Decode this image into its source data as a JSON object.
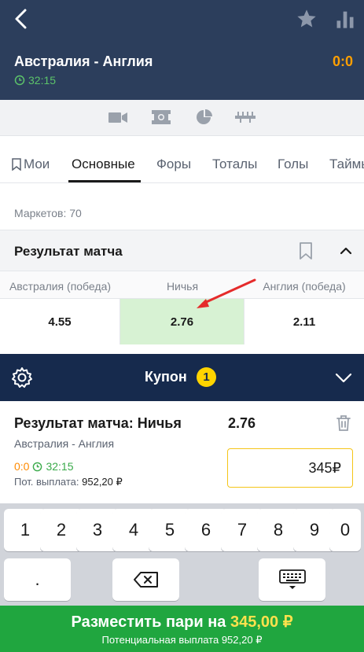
{
  "header": {
    "title": "Австралия - Англия",
    "score": "0:0",
    "time": "32:15"
  },
  "media_icons": [
    "video-icon",
    "field-icon",
    "stats-pie-icon",
    "timeline-icon"
  ],
  "tabs": [
    {
      "label": "Мои",
      "icon": "bookmark-icon"
    },
    {
      "label": "Основные",
      "active": true
    },
    {
      "label": "Форы"
    },
    {
      "label": "Тоталы"
    },
    {
      "label": "Голы"
    },
    {
      "label": "Таймы"
    }
  ],
  "markets": {
    "count_text": "Маркетов: 70"
  },
  "market": {
    "title": "Результат матча",
    "outcomes": [
      {
        "label": "Австралия (победа)",
        "odd": "4.55",
        "selected": false
      },
      {
        "label": "Ничья",
        "odd": "2.76",
        "selected": true
      },
      {
        "label": "Англия (победа)",
        "odd": "2.11",
        "selected": false
      }
    ]
  },
  "coupon": {
    "title": "Купон",
    "count": "1",
    "bet": {
      "title": "Результат матча: Ничья",
      "odd": "2.76",
      "match": "Австралия - Англия",
      "score": "0:0",
      "time": "32:15",
      "payout_label": "Пот. выплата:",
      "payout_value": "952,20 ₽",
      "stake": "345₽"
    }
  },
  "keyboard": {
    "keys": [
      "1",
      "2",
      "3",
      "4",
      "5",
      "6",
      "7",
      "8",
      "9",
      "0"
    ],
    "dot": "."
  },
  "place_bet": {
    "label": "Разместить пари на",
    "amount": "345,00 ₽",
    "sub": "Потенциальная выплата 952,20 ₽"
  },
  "colors": {
    "header_bg": "#2c3e5c",
    "coupon_bg": "#162a4d",
    "accent_orange": "#ff9f00",
    "selected_bg": "#d7f2d3",
    "place_bet_bg": "#20a63f",
    "badge": "#ffd400",
    "arrow": "#e52b2b"
  }
}
